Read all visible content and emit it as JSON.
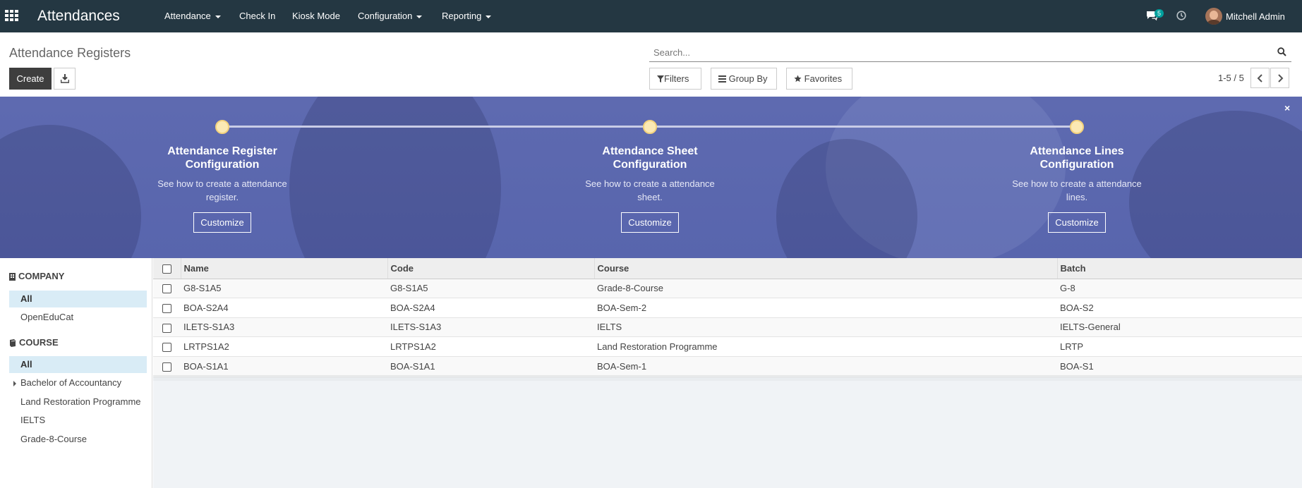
{
  "navbar": {
    "app_title": "Attendances",
    "menu": [
      {
        "label": "Attendance",
        "dropdown": true
      },
      {
        "label": "Check In",
        "dropdown": false
      },
      {
        "label": "Kiosk Mode",
        "dropdown": false
      },
      {
        "label": "Configuration",
        "dropdown": true
      },
      {
        "label": "Reporting",
        "dropdown": true
      }
    ],
    "messages_count": "5",
    "user_name": "Mitchell Admin",
    "bg_color": "#243742"
  },
  "control_panel": {
    "breadcrumb": "Attendance Registers",
    "create_label": "Create",
    "search_placeholder": "Search...",
    "filters_label": "Filters",
    "group_by_label": "Group By",
    "favorites_label": "Favorites",
    "pager": "1-5 / 5"
  },
  "banner": {
    "steps": [
      {
        "title_line1": "Attendance Register",
        "title_line2": "Configuration",
        "desc_line1": "See how to create a attendance",
        "desc_line2": "register.",
        "button": "Customize"
      },
      {
        "title_line1": "Attendance Sheet",
        "title_line2": "Configuration",
        "desc_line1": "See how to create a attendance",
        "desc_line2": "sheet.",
        "button": "Customize"
      },
      {
        "title_line1": "Attendance Lines",
        "title_line2": "Configuration",
        "desc_line1": "See how to create a attendance",
        "desc_line2": "lines.",
        "button": "Customize"
      }
    ],
    "close_glyph": "×"
  },
  "sidebar": {
    "company": {
      "heading": "COMPANY",
      "items": [
        "All",
        "OpenEduCat"
      ]
    },
    "course": {
      "heading": "COURSE",
      "items": [
        "All",
        "Bachelor of Accountancy",
        "Land Restoration Programme",
        "IELTS",
        "Grade-8-Course"
      ]
    }
  },
  "table": {
    "columns": [
      "Name",
      "Code",
      "Course",
      "Batch"
    ],
    "rows": [
      [
        "G8-S1A5",
        "G8-S1A5",
        "Grade-8-Course",
        "G-8"
      ],
      [
        "BOA-S2A4",
        "BOA-S2A4",
        "BOA-Sem-2",
        "BOA-S2"
      ],
      [
        "ILETS-S1A3",
        "ILETS-S1A3",
        "IELTS",
        "IELTS-General"
      ],
      [
        "LRTPS1A2",
        "LRTPS1A2",
        "Land Restoration Programme",
        "LRTP"
      ],
      [
        "BOA-S1A1",
        "BOA-S1A1",
        "BOA-Sem-1",
        "BOA-S1"
      ]
    ]
  },
  "colors": {
    "banner": "#5e6ab0",
    "active_filter": "#d9ecf6",
    "badge": "#00a09d",
    "primary_button": "#3e3e3e"
  }
}
